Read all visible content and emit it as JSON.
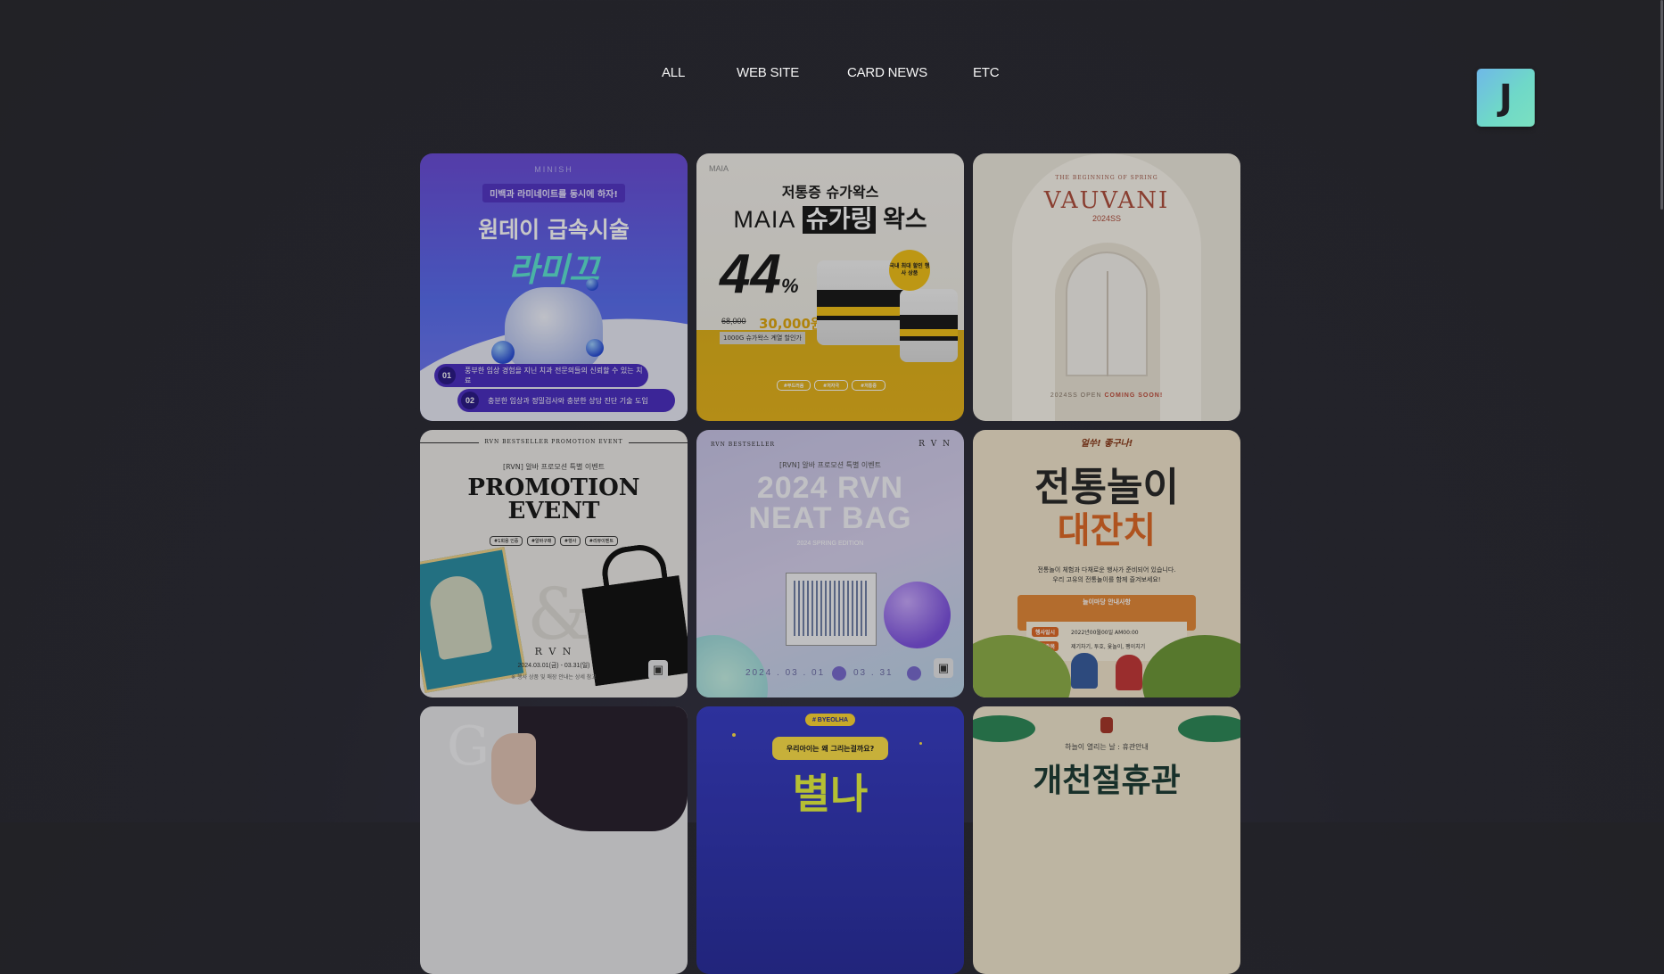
{
  "nav": {
    "items": [
      {
        "label": "ALL"
      },
      {
        "label": "WEB SITE"
      },
      {
        "label": "CARD NEWS"
      },
      {
        "label": "ETC"
      }
    ]
  },
  "logo": {
    "letter": "J",
    "colors": [
      "#6fb8e8",
      "#7be0c0"
    ]
  },
  "cards": [
    {
      "brand": "MINISH",
      "tagline": "미백과 라미네이트를 동시에 하자!",
      "headline": "원데이 급속시술",
      "title": "라미끄",
      "point1_num": "01",
      "point1": "풍부한 임상 경험을 지닌 치과 전문의들의 신뢰할 수 있는 치료",
      "point2_num": "02",
      "point2": "충분한 임상과 정밀검사와 충분한 상담 진단 기술 도입"
    },
    {
      "brand": "MAIA",
      "tagline": "저통증 슈가왁스",
      "headline_a": "MAIA",
      "headline_b": "슈가링",
      "headline_c": "왁스",
      "discount": "44",
      "percent": "%",
      "old_price": "68,000",
      "new_price": "30,000원",
      "note": "1000G 슈가왁스 계열 할인가",
      "seal": "국내 최대 할인 행사 상품",
      "chips": [
        "#부드러움",
        "#저자극",
        "#저통증"
      ]
    },
    {
      "kicker": "THE BEGINNING OF SPRING",
      "title": "VAUVANI",
      "subtitle": "2024SS",
      "footer_a": "2024SS OPEN",
      "footer_b": "COMING SOON!"
    },
    {
      "kicker": "RVN BESTSELLER PROMOTION EVENT",
      "tagline": "[RVN] 알바 프로모션 특별 이벤트",
      "title_line1": "PROMOTION",
      "title_line2": "EVENT",
      "chips": [
        "#1회용 인증",
        "#알바구매",
        "#행사",
        "#리뷰이벤트"
      ],
      "brand": "R V N",
      "dates": "2024.03.01(금) - 03.31(일)",
      "note": "※ 행사 상품 및 매장 안내는 상세 참고"
    },
    {
      "kicker": "RVN BESTSELLER",
      "brand": "R V N",
      "tagline": "[RVN] 알바 프로모션 특별 이벤트",
      "title_line1": "2024 RVN",
      "title_line2": "NEAT BAG",
      "subline": "2024 SPRING EDITION",
      "date_start": "2024 . 03 . 01",
      "date_end": "03 . 31"
    },
    {
      "kicker": "얼쑤! 좋구나!",
      "title_line1": "전통놀이",
      "title_line2": "대잔치",
      "desc1": "전통놀이 체험과 다채로운 행사가 준비되어 있습니다.",
      "desc2": "우리 고유의 전통놀이를 함께 즐겨보세요!",
      "panel_title": "놀이마당 안내사항",
      "row1_label": "행사일시",
      "row1_value": "2022년00월00일 AM00:00",
      "row2_label": "놀이종목",
      "row2_value": "제기차기, 투호, 윷놀이, 팽이치기"
    },
    {
      "letters": "GR"
    },
    {
      "tag": "# BYEOLHA",
      "question": "우리아이는 왜 그리는걸까요?",
      "title": "별나"
    },
    {
      "kicker": "하늘이 열리는 날 : 휴관안내",
      "title": "개천절휴관"
    }
  ]
}
